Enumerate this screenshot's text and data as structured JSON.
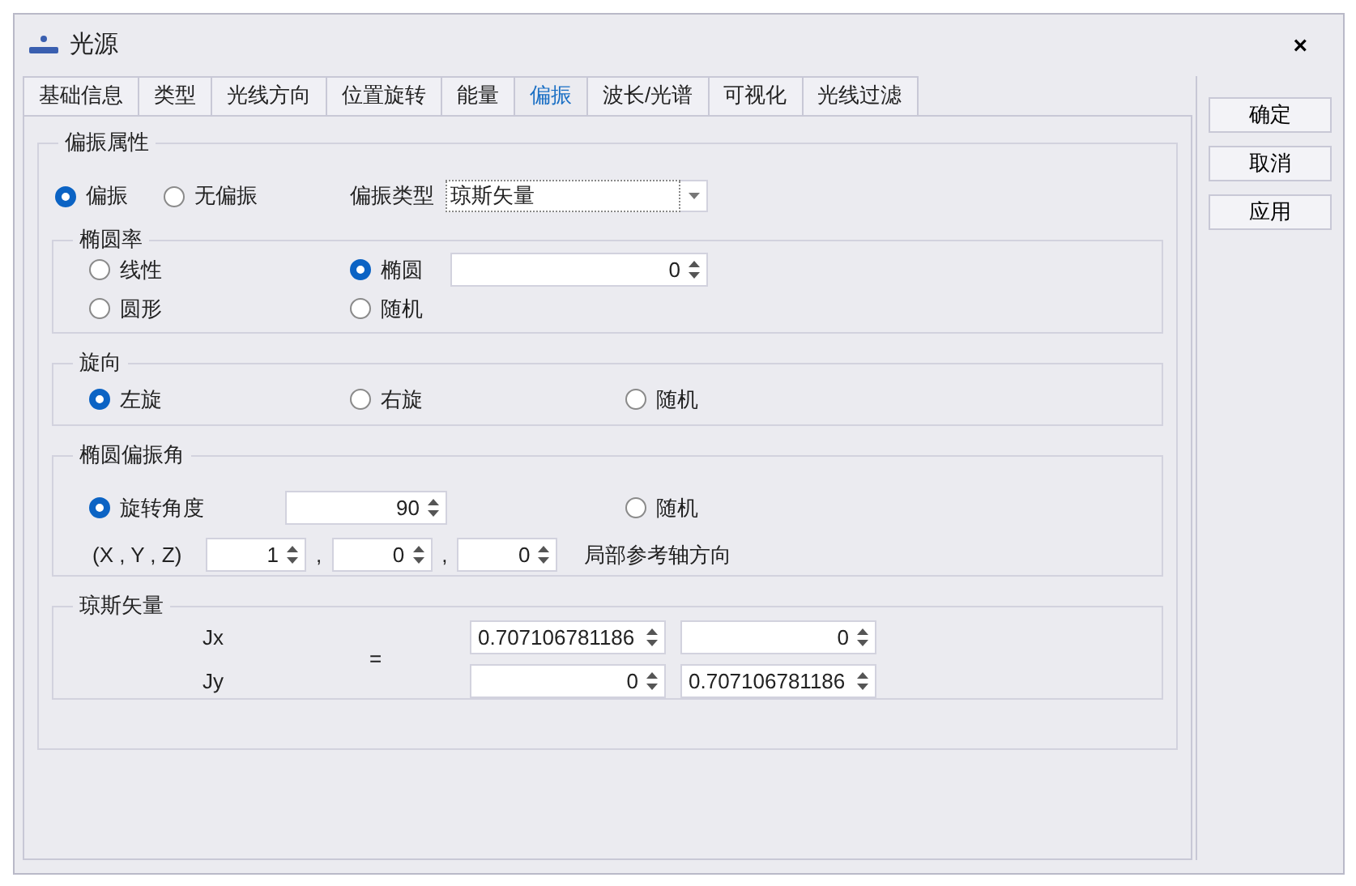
{
  "window": {
    "title": "光源",
    "close": "×"
  },
  "tabs": [
    {
      "label": "基础信息",
      "selected": false
    },
    {
      "label": "类型",
      "selected": false
    },
    {
      "label": "光线方向",
      "selected": false
    },
    {
      "label": "位置旋转",
      "selected": false
    },
    {
      "label": "能量",
      "selected": false
    },
    {
      "label": "偏振",
      "selected": true
    },
    {
      "label": "波长/光谱",
      "selected": false
    },
    {
      "label": "可视化",
      "selected": false
    },
    {
      "label": "光线过滤",
      "selected": false
    }
  ],
  "buttons": [
    "确定",
    "取消",
    "应用"
  ],
  "polarization": {
    "title": "偏振属性",
    "modes": [
      {
        "label": "偏振",
        "selected": true
      },
      {
        "label": "无偏振",
        "selected": false
      }
    ],
    "type_label": "偏振类型",
    "type_value": "琼斯矢量"
  },
  "ellipticity": {
    "title": "椭圆率",
    "options": [
      {
        "label": "线性",
        "selected": false
      },
      {
        "label": "椭圆",
        "selected": true
      },
      {
        "label": "圆形",
        "selected": false
      },
      {
        "label": "随机",
        "selected": false
      }
    ],
    "value": "0"
  },
  "handedness": {
    "title": "旋向",
    "options": [
      {
        "label": "左旋",
        "selected": true
      },
      {
        "label": "右旋",
        "selected": false
      },
      {
        "label": "随机",
        "selected": false
      }
    ]
  },
  "ellipse_angle": {
    "title": "椭圆偏振角",
    "options": [
      {
        "label": "旋转角度",
        "selected": true
      },
      {
        "label": "随机",
        "selected": false
      }
    ],
    "angle": "90",
    "xyz_label": "(X , Y , Z)",
    "xyz": [
      "1",
      "0",
      "0"
    ],
    "separators": [
      ",",
      ","
    ],
    "axis_label": "局部参考轴方向"
  },
  "jones": {
    "title": "琼斯矢量",
    "labels": [
      "Jx",
      "Jy"
    ],
    "equals": "=",
    "values": [
      [
        "0.707106781186",
        "0"
      ],
      [
        "0",
        "0.707106781186"
      ]
    ]
  }
}
